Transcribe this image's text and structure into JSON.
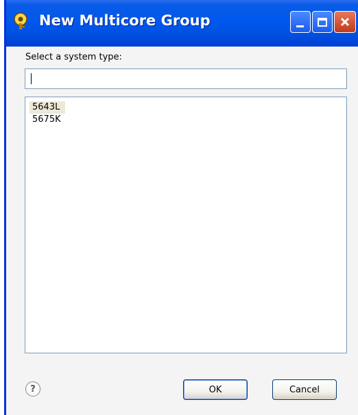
{
  "window": {
    "title": "New Multicore Group",
    "icon": "eclipse-key-icon",
    "controls": [
      "minimize",
      "maximize",
      "close"
    ]
  },
  "dialog": {
    "prompt": "Select a system type:",
    "filter": {
      "value": "",
      "placeholder": ""
    },
    "system_types": [
      {
        "label": "5643L",
        "selected": true
      },
      {
        "label": "5675K",
        "selected": false
      }
    ]
  },
  "footer": {
    "help_label": "?",
    "ok_label": "OK",
    "cancel_label": "Cancel"
  },
  "colors": {
    "titlebar": "#0058ee",
    "client": "#f4f4f4",
    "border": "#7f9db9",
    "close": "#c2381c"
  }
}
